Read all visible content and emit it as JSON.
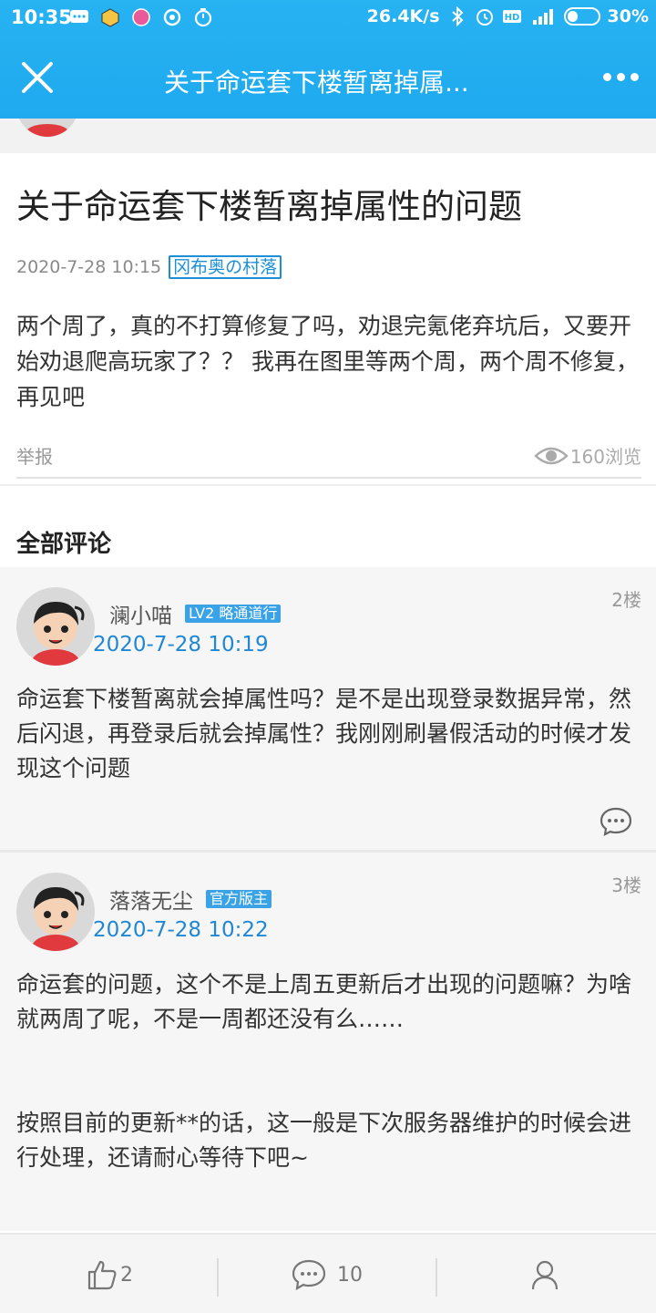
{
  "status_bar": {
    "time": "10:35",
    "net_speed": "26.4K/s",
    "battery": "30%",
    "icons": [
      "chat-bubble-icon",
      "cube-icon",
      "app-badge-icon",
      "music-icon",
      "timer-icon",
      "bluetooth-icon",
      "alarm-icon",
      "hd-icon",
      "signal-icon"
    ]
  },
  "header": {
    "title": "关于命运套下楼暂离掉属...",
    "close_icon": "close-icon",
    "more_icon": "more-icon"
  },
  "post": {
    "title": "关于命运套下楼暂离掉属性的问题",
    "date": "2020-7-28 10:15",
    "tag": "冈布奥の村落",
    "body": "两个周了，真的不打算修复了吗，劝退完氪佬弃坑后，又要开始劝退爬高玩家了？？ 我再在图里等两个周，两个周不修复，再见吧",
    "report_label": "举报",
    "views": "160浏览"
  },
  "comments_section": {
    "heading": "全部评论",
    "comments": [
      {
        "name": "澜小喵",
        "badge": "LV2 略通道行",
        "date": "2020-7-28 10:19",
        "floor": "2楼",
        "text": "命运套下楼暂离就会掉属性吗？是不是出现登录数据异常，然后闪退，再登录后就会掉属性？我刚刚刷暑假活动的时候才发现这个问题"
      },
      {
        "name": "落落无尘",
        "badge": "官方版主",
        "date": "2020-7-28 10:22",
        "floor": "3楼",
        "text_lines": [
          "命运套的问题，这个不是上周五更新后才出现的问题嘛？为啥就两周了呢，不是一周都还没有么……",
          "按照目前的更新**的话，这一般是下次服务器维护的时候会进行处理，还请耐心等待下吧~"
        ]
      }
    ]
  },
  "bottom_bar": {
    "likes": "2",
    "comments": "10"
  },
  "colors": {
    "header_bg": "#1fa9ef",
    "link_blue": "#1f87d4",
    "badge_bg": "#3aa2e6"
  }
}
